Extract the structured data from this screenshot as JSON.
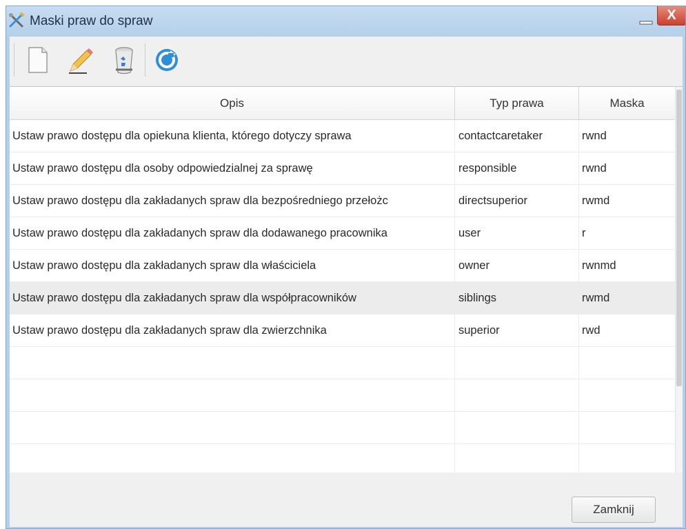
{
  "window": {
    "title": "Maski praw do spraw",
    "close_glyph": "X",
    "icon": "tools-icon"
  },
  "toolbar": {
    "buttons": [
      {
        "name": "new-document-icon",
        "tooltip": ""
      },
      {
        "name": "edit-pencil-icon",
        "tooltip": ""
      },
      {
        "name": "delete-trash-icon",
        "tooltip": ""
      },
      {
        "name": "refresh-icon",
        "tooltip": ""
      }
    ]
  },
  "grid": {
    "columns": [
      "Opis",
      "Typ prawa",
      "Maska"
    ],
    "selected_row_index": 5,
    "rows": [
      {
        "opis": "Ustaw prawo dostępu dla opiekuna klienta, którego dotyczy sprawa",
        "typ": "contactcaretaker",
        "maska": "rwnd"
      },
      {
        "opis": "Ustaw prawo dostępu dla osoby odpowiedzialnej za sprawę",
        "typ": "responsible",
        "maska": "rwnd"
      },
      {
        "opis": "Ustaw prawo dostępu dla zakładanych spraw dla bezpośredniego przełożc",
        "typ": "directsuperior",
        "maska": "rwmd"
      },
      {
        "opis": "Ustaw prawo dostępu dla zakładanych spraw dla dodawanego pracownika",
        "typ": "user",
        "maska": "r"
      },
      {
        "opis": "Ustaw prawo dostępu dla zakładanych spraw dla właściciela",
        "typ": "owner",
        "maska": "rwnmd"
      },
      {
        "opis": "Ustaw prawo dostępu dla zakładanych spraw dla współpracowników",
        "typ": "siblings",
        "maska": "rwmd"
      },
      {
        "opis": "Ustaw prawo dostępu dla zakładanych spraw dla zwierzchnika",
        "typ": "superior",
        "maska": "rwd"
      },
      {
        "opis": "",
        "typ": "",
        "maska": ""
      },
      {
        "opis": "",
        "typ": "",
        "maska": ""
      },
      {
        "opis": "",
        "typ": "",
        "maska": ""
      },
      {
        "opis": "",
        "typ": "",
        "maska": ""
      }
    ]
  },
  "footer": {
    "close_label": "Zamknij"
  },
  "colors": {
    "titlebar": "#b5d0ea",
    "close_button": "#c9412f",
    "selected_row": "#ececec"
  }
}
